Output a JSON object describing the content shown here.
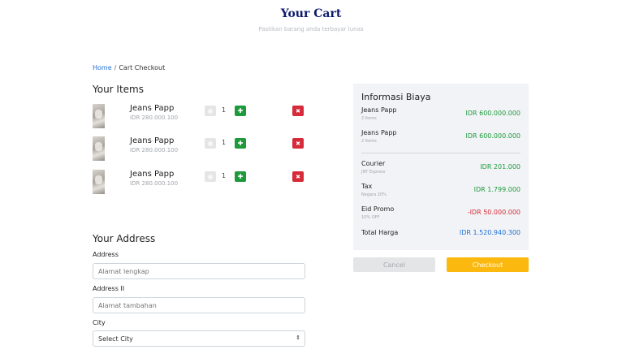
{
  "header": {
    "title": "Your Cart",
    "subtitle": "Pastikan barang anda terbayar lunas"
  },
  "breadcrumb": {
    "home": "Home",
    "separator": "/",
    "current": "Cart Checkout"
  },
  "items_section": {
    "title": "Your Items",
    "items": [
      {
        "name": "Jeans Papp",
        "price": "IDR 280.000.100",
        "qty": "1",
        "minus_icon": "minus-circle-icon",
        "plus_icon": "plus-circle-icon",
        "remove_icon": "close-circle-icon"
      },
      {
        "name": "Jeans Papp",
        "price": "IDR 280.000.100",
        "qty": "1",
        "minus_icon": "minus-circle-icon",
        "plus_icon": "plus-circle-icon",
        "remove_icon": "close-circle-icon"
      },
      {
        "name": "Jeans Papp",
        "price": "IDR 280.000.100",
        "qty": "1",
        "minus_icon": "minus-circle-icon",
        "plus_icon": "plus-circle-icon",
        "remove_icon": "close-circle-icon"
      }
    ]
  },
  "address_section": {
    "title": "Your Address",
    "address_label": "Address",
    "address_placeholder": "Alamat lengkap",
    "address2_label": "Address II",
    "address2_placeholder": "Alamat tambahan",
    "city_label": "City",
    "city_selected": "Select City"
  },
  "summary": {
    "title": "Informasi Biaya",
    "line_items": [
      {
        "label": "Jeans Papp",
        "sub": "2 Items",
        "value": "IDR 600.000.000"
      },
      {
        "label": "Jeans Papp",
        "sub": "2 Items",
        "value": "IDR 600.000.000"
      }
    ],
    "courier": {
      "label": "Courier",
      "sub": "JNT Express",
      "value": "IDR 201.000"
    },
    "tax": {
      "label": "Tax",
      "sub": "Negara 20%",
      "value": "IDR 1.799.000"
    },
    "promo": {
      "label": "Eid Promo",
      "sub": "10% OFF",
      "value": "-IDR 50.000.000"
    },
    "total": {
      "label": "Total Harga",
      "value": "IDR 1.520.940.300"
    }
  },
  "actions": {
    "cancel": "Cancel",
    "checkout": "Checkout"
  },
  "colors": {
    "title": "#0d1a6b",
    "accent_link": "#1f6fd1",
    "plus_button": "#1e9a3c",
    "remove_button": "#d62b3a",
    "checkout_button": "#fbb80f",
    "panel_bg": "#f1f3f6"
  }
}
